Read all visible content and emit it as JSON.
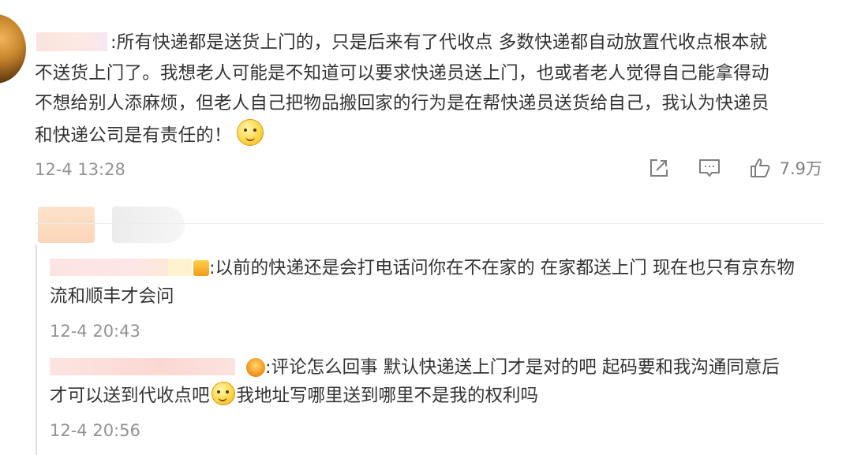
{
  "main_comment": {
    "text_line1": ":所有快递都是送货上门的，只是后来有了代收点 多数快递都自动放置代收点根本就",
    "text_line2": "不送货上门了。我想老人可能是不知道可以要求快递员送上门，也或者老人觉得自己能拿得动",
    "text_line3": "不想给别人添麻烦，但老人自己把物品搬回家的行为是在帮快递员送货给自己，我认为快递员",
    "text_line4": "和快递公司是有责任的！",
    "emoji_icon": "thinking-face-emoji",
    "timestamp": "12-4 13:28",
    "like_count": "7.9万"
  },
  "replies": [
    {
      "text_line1": ":以前的快递还是会打电话问你在不在家的 在家都送上门 现在也只有京东物",
      "text_line2": "流和顺丰才会问",
      "timestamp": "12-4 20:43"
    },
    {
      "text_line1": ":评论怎么回事 默认快递送上门才是对的吧 起码要和我沟通同意后",
      "text_line2a": "才可以送到代收点吧",
      "text_line2b": "我地址写哪里送到哪里不是我的权利吗",
      "emoji_icon": "speechless-face-emoji",
      "timestamp": "12-4 20:56"
    }
  ],
  "icons": {
    "share": "share-icon",
    "comment": "comment-icon",
    "like": "thumbs-up-icon"
  },
  "colors": {
    "text": "#333333",
    "muted": "#939393",
    "icon": "#7f7f7f"
  }
}
